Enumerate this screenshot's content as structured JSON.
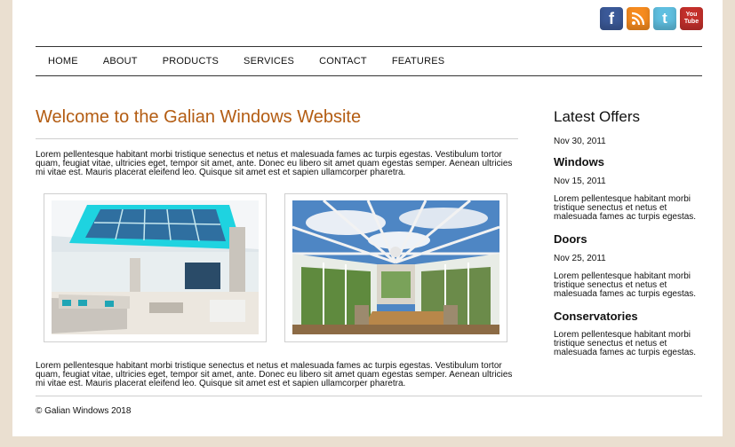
{
  "social": [
    {
      "name": "facebook-icon",
      "glyph": "f"
    },
    {
      "name": "rss-icon",
      "glyph": ""
    },
    {
      "name": "twitter-icon",
      "glyph": "t"
    },
    {
      "name": "youtube-icon",
      "line1": "You",
      "line2": "Tube"
    }
  ],
  "nav": {
    "items": [
      "HOME",
      "ABOUT",
      "PRODUCTS",
      "SERVICES",
      "CONTACT",
      "FEATURES"
    ]
  },
  "main": {
    "title": "Welcome to the Galian Windows Website",
    "paragraph1": "Lorem pellentesque habitant morbi tristique senectus et netus et malesuada fames ac turpis egestas. Vestibulum tortor quam, feugiat vitae, ultricies eget, tempor sit amet, ante. Donec eu libero sit amet quam egestas semper. Aenean ultricies mi vitae est. Mauris placerat eleifend leo. Quisque sit amet est et sapien ullamcorper pharetra.",
    "paragraph2": "Lorem pellentesque habitant morbi tristique senectus et netus et malesuada fames ac turpis egestas. Vestibulum tortor quam, feugiat vitae, ultricies eget, tempor sit amet, ante. Donec eu libero sit amet quam egestas semper. Aenean ultricies mi vitae est. Mauris placerat eleifend leo. Quisque sit amet est et sapien ullamcorper pharetra."
  },
  "sidebar": {
    "title": "Latest Offers",
    "date_top": "Nov 30, 2011",
    "offers": [
      {
        "heading": "Windows",
        "date": "Nov 15, 2011",
        "text": "Lorem pellentesque habitant morbi tristique senectus et netus et malesuada fames ac turpis egestas."
      },
      {
        "heading": "Doors",
        "date": "Nov 25, 2011",
        "text": "Lorem pellentesque habitant morbi tristique senectus et netus et malesuada fames ac turpis egestas."
      },
      {
        "heading": "Conservatories",
        "text": "Lorem pellentesque habitant morbi tristique senectus et netus et malesuada fames ac turpis egestas."
      }
    ]
  },
  "footer": {
    "copyright": "© Galian Windows 2018"
  },
  "colors": {
    "background": "#eadfd0",
    "title": "#b35c12"
  }
}
